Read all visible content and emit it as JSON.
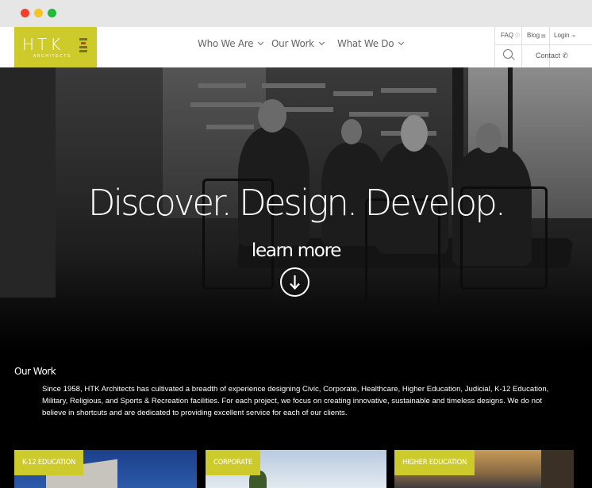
{
  "brand": {
    "name": "HTK",
    "tagline": "ARCHITECTS",
    "color": "#cdca2c"
  },
  "nav": [
    {
      "label": "Who We Are"
    },
    {
      "label": "Our Work"
    },
    {
      "label": "What We Do"
    }
  ],
  "utility": {
    "faq": "FAQ",
    "blog": "Blog",
    "login": "Login",
    "contact": "Contact"
  },
  "hero": {
    "title": "Discover. Design. Develop.",
    "cta": "learn more"
  },
  "our_work": {
    "title": "Our Work",
    "body": "Since 1958, HTK Architects has cultivated a breadth of experience designing Civic, Corporate, Healthcare, Higher Education, Judicial, K-12 Education, Military, Religious, and Sports & Recreation facilities. For each project, we focus on creating innovative, sustainable and timeless designs. We do not believe in shortcuts and are dedicated to providing excellent service for each of our clients."
  },
  "cards": [
    {
      "label": "K-12 EDUCATION"
    },
    {
      "label": "CORPORATE"
    },
    {
      "label": "HIGHER EDUCATION"
    }
  ]
}
